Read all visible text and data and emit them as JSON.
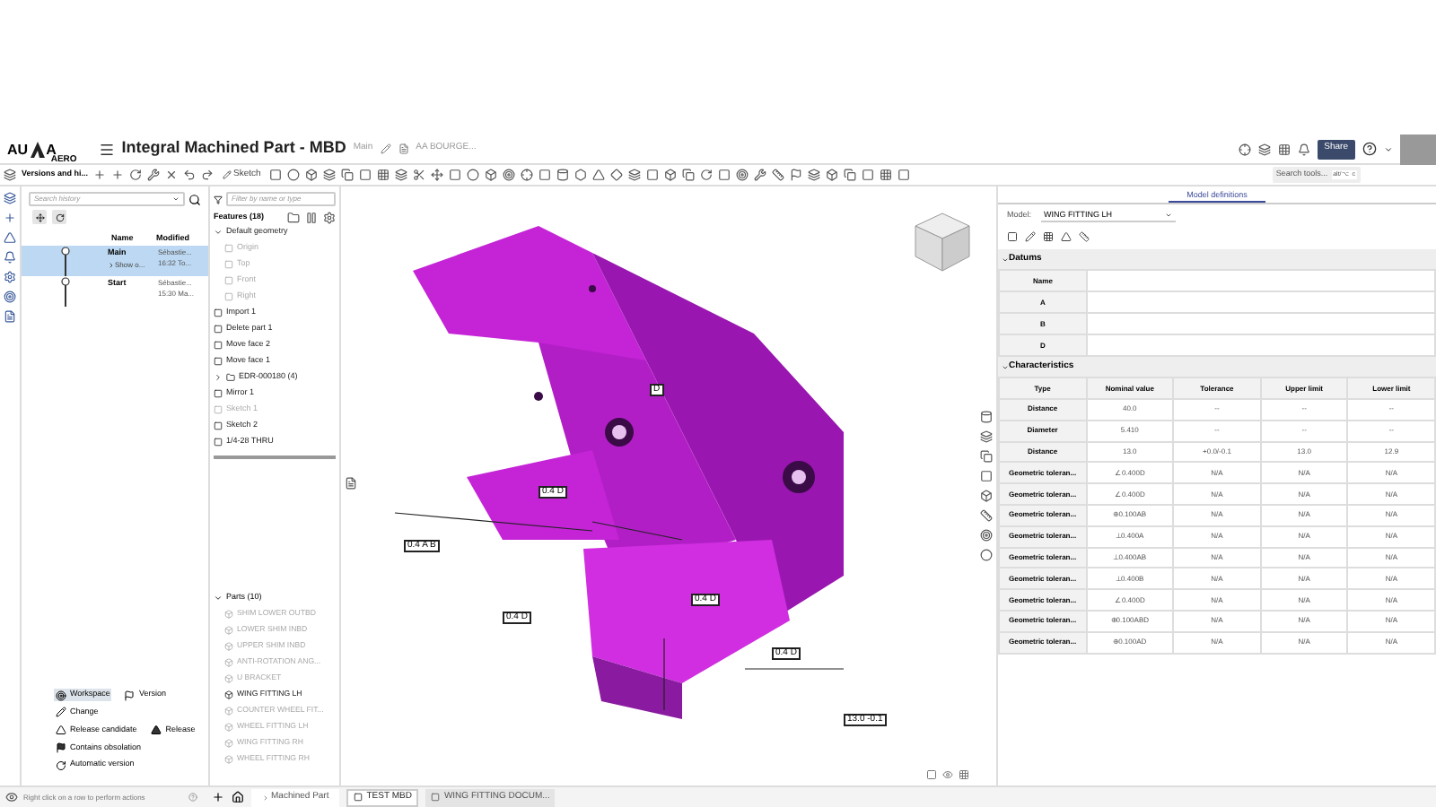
{
  "header": {
    "logo_left": "AU",
    "logo_right": "A",
    "logo_sub": "AERO",
    "title": "Integral Machined Part - MBD",
    "branch": "Main",
    "owner": "AA BOURGE...",
    "share": "Share"
  },
  "toolbar": {
    "panel_title": "Versions and hi...",
    "sketch": "Sketch",
    "search": "Search tools...",
    "shortcut": "alt/⌥ c"
  },
  "versions": {
    "search_placeholder": "Search history",
    "columns": [
      "Name",
      "Modified"
    ],
    "rows": [
      {
        "name": "Main",
        "sub": "Show o...",
        "author": "Sébastie...",
        "time": "16:32 To...",
        "selected": true
      },
      {
        "name": "Start",
        "sub": "",
        "author": "Sébastie...",
        "time": "15:30 Ma...",
        "selected": false
      }
    ],
    "legend": [
      {
        "kind": "workspace",
        "label": "Workspace",
        "selected": true
      },
      {
        "kind": "version",
        "label": "Version",
        "selected": false
      },
      {
        "kind": "change",
        "label": "Change",
        "selected": false
      },
      {
        "kind": "candidate",
        "label": "Release candidate",
        "selected": false
      },
      {
        "kind": "release",
        "label": "Release",
        "selected": false
      },
      {
        "kind": "obsolete",
        "label": "Contains obsolation",
        "selected": false
      },
      {
        "kind": "auto",
        "label": "Automatic version",
        "selected": false
      }
    ]
  },
  "features": {
    "filter_placeholder": "Filter by name or type",
    "title": "Features (18)",
    "tree": [
      {
        "label": "Default geometry",
        "expanded": true,
        "disabled": false,
        "children": [
          {
            "label": "Origin",
            "disabled": true
          },
          {
            "label": "Top",
            "disabled": true
          },
          {
            "label": "Front",
            "disabled": true
          },
          {
            "label": "Right",
            "disabled": true
          }
        ]
      },
      {
        "label": "Import 1",
        "disabled": false
      },
      {
        "label": "Delete part 1",
        "disabled": false
      },
      {
        "label": "Move face 2",
        "disabled": false
      },
      {
        "label": "Move face 1",
        "disabled": false
      },
      {
        "label": "EDR-000180 (4)",
        "kind": "folder",
        "expanded": false,
        "disabled": false
      },
      {
        "label": "Mirror 1",
        "disabled": false
      },
      {
        "label": "Sketch 1",
        "disabled": true
      },
      {
        "label": "Sketch 2",
        "disabled": false
      },
      {
        "label": "1/4-28 THRU",
        "disabled": false
      }
    ],
    "parts_title": "Parts (10)",
    "parts": [
      {
        "label": "SHIM LOWER OUTBD",
        "disabled": true
      },
      {
        "label": "LOWER SHIM INBD",
        "disabled": true
      },
      {
        "label": "UPPER SHIM INBD",
        "disabled": true
      },
      {
        "label": "ANTI-ROTATION ANG...",
        "disabled": true
      },
      {
        "label": "U BRACKET",
        "disabled": true
      },
      {
        "label": "WING FITTING LH",
        "disabled": false
      },
      {
        "label": "COUNTER WHEEL FIT...",
        "disabled": true
      },
      {
        "label": "WHEEL FITTING LH",
        "disabled": true
      },
      {
        "label": "WING FITTING RH",
        "disabled": true
      },
      {
        "label": "WHEEL FITTING RH",
        "disabled": true
      }
    ]
  },
  "viewport": {
    "annotations": [
      "0.4 D",
      "0.4 A B",
      "D",
      "0.4 D",
      "0.4 D",
      "0.4 D",
      "13.0 -0.1"
    ]
  },
  "model_panel": {
    "tab": {
      "label": "Model definitions",
      "selected": true
    },
    "model_label": "Model:",
    "model_value": "WING FITTING LH",
    "datums_title": "Datums",
    "datums_header": "Name",
    "datums": [
      "A",
      "B",
      "D"
    ],
    "characteristics_title": "Characteristics",
    "columns": [
      "Type",
      "Nominal value",
      "Tolerance",
      "Upper limit",
      "Lower limit"
    ],
    "rows": [
      [
        "Distance",
        "40.0",
        "--",
        "--",
        "--"
      ],
      [
        "Diameter",
        "5.410",
        "--",
        "--",
        "--"
      ],
      [
        "Distance",
        "13.0",
        "+0.0/-0.1",
        "13.0",
        "12.9"
      ],
      [
        "Geometric toleran...",
        "∠0.400D",
        "N/A",
        "N/A",
        "N/A"
      ],
      [
        "Geometric toleran...",
        "∠0.400D",
        "N/A",
        "N/A",
        "N/A"
      ],
      [
        "Geometric toleran...",
        "⊕0.100AB",
        "N/A",
        "N/A",
        "N/A"
      ],
      [
        "Geometric toleran...",
        "⊥0.400A",
        "N/A",
        "N/A",
        "N/A"
      ],
      [
        "Geometric toleran...",
        "⊥0.400AB",
        "N/A",
        "N/A",
        "N/A"
      ],
      [
        "Geometric toleran...",
        "⊥0.400B",
        "N/A",
        "N/A",
        "N/A"
      ],
      [
        "Geometric toleran...",
        "∠0.400D",
        "N/A",
        "N/A",
        "N/A"
      ],
      [
        "Geometric toleran...",
        "⊕0.100ABD",
        "N/A",
        "N/A",
        "N/A"
      ],
      [
        "Geometric toleran...",
        "⊕0.100AD",
        "N/A",
        "N/A",
        "N/A"
      ]
    ]
  },
  "status": {
    "hint": "Right click on a row to perform actions",
    "breadcrumb": "Machined Part",
    "tabs": [
      {
        "label": "TEST MBD",
        "selected": true
      },
      {
        "label": "WING FITTING DOCUM...",
        "selected": false
      }
    ]
  }
}
